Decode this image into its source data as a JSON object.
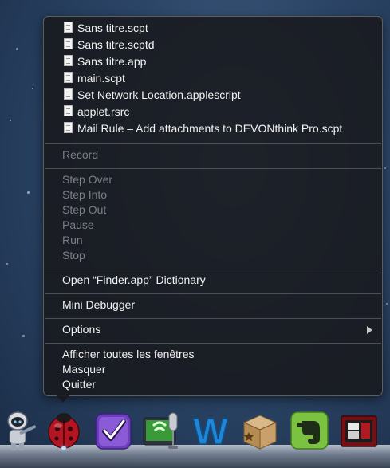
{
  "menu": {
    "recent_files": [
      {
        "label": "Sans titre.scpt"
      },
      {
        "label": "Sans titre.scptd"
      },
      {
        "label": "Sans titre.app"
      },
      {
        "label": "main.scpt"
      },
      {
        "label": "Set Network Location.applescript"
      },
      {
        "label": "applet.rsrc"
      },
      {
        "label": "Mail Rule – Add attachments to DEVONthink Pro.scpt"
      }
    ],
    "record": "Record",
    "debug_items": [
      "Step Over",
      "Step Into",
      "Step Out",
      "Pause",
      "Run",
      "Stop"
    ],
    "open_dictionary": "Open “Finder.app” Dictionary",
    "mini_debugger": "Mini Debugger",
    "options": "Options",
    "show_all_windows": "Afficher toutes les fenêtres",
    "hide": "Masquer",
    "quit": "Quitter"
  },
  "dock": {
    "icons": [
      {
        "name": "automator-icon"
      },
      {
        "name": "script-debugger-ladybug-icon"
      },
      {
        "name": "omnifocus-icon"
      },
      {
        "name": "dictation-microphone-icon"
      },
      {
        "name": "word-w-icon"
      },
      {
        "name": "archive-box-icon"
      },
      {
        "name": "evernote-icon"
      },
      {
        "name": "photo-booth-icon"
      }
    ]
  }
}
